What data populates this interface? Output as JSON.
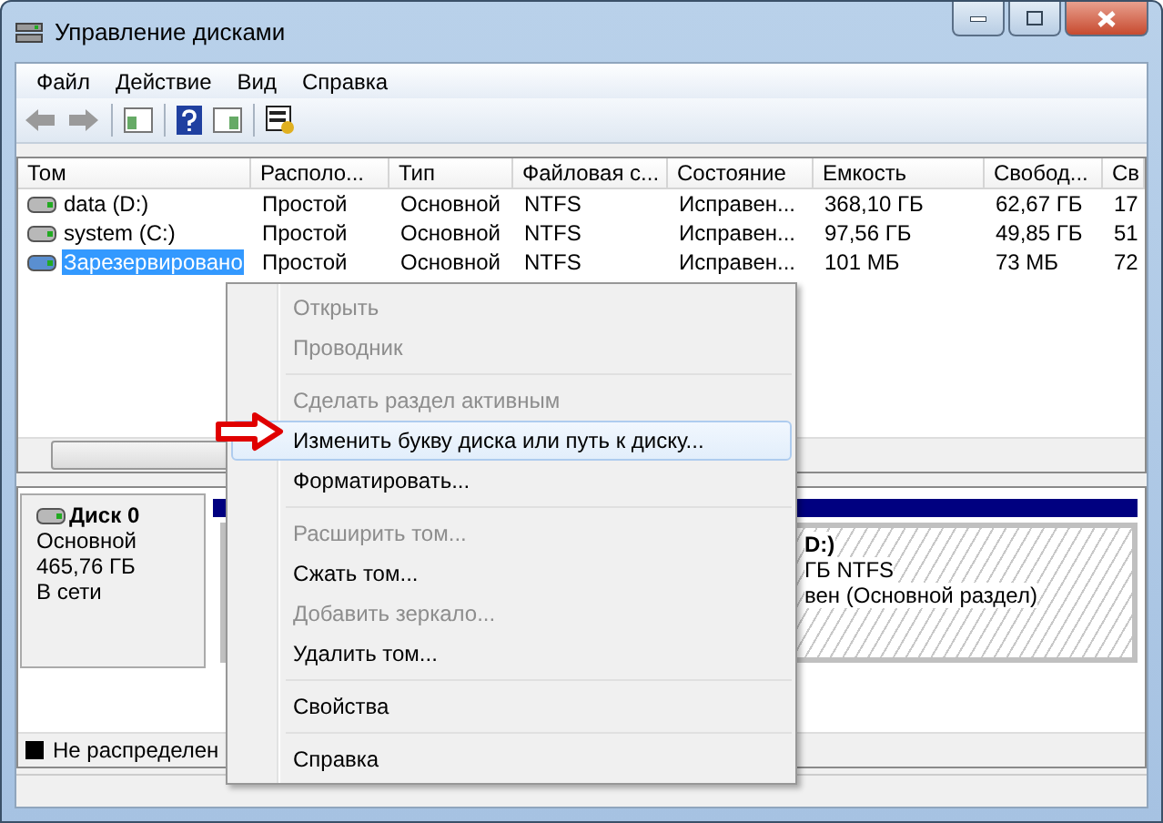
{
  "window": {
    "title": "Управление дисками"
  },
  "menu_bar": [
    "Файл",
    "Действие",
    "Вид",
    "Справка"
  ],
  "volumes": {
    "columns": [
      "Том",
      "Располо...",
      "Тип",
      "Файловая с...",
      "Состояние",
      "Емкость",
      "Свобод...",
      "Св"
    ],
    "rows": [
      {
        "selected": false,
        "cells": [
          "data (D:)",
          "Простой",
          "Основной",
          "NTFS",
          "Исправен...",
          "368,10 ГБ",
          "62,67 ГБ",
          "17"
        ]
      },
      {
        "selected": false,
        "cells": [
          "system (C:)",
          "Простой",
          "Основной",
          "NTFS",
          "Исправен...",
          "97,56 ГБ",
          "49,85 ГБ",
          "51"
        ]
      },
      {
        "selected": true,
        "cells": [
          "Зарезервировано",
          "Простой",
          "Основной",
          "NTFS",
          "Исправен...",
          "101 МБ",
          "73 МБ",
          "72"
        ]
      }
    ]
  },
  "disk": {
    "name": "Диск 0",
    "type": "Основной",
    "size": "465,76 ГБ",
    "status": "В сети"
  },
  "partition": {
    "lines": [
      "D:)",
      "ГБ NTFS",
      "вен (Основной раздел)"
    ]
  },
  "legend": [
    {
      "label": "Не распределен",
      "color": "#000000"
    }
  ],
  "context_menu": {
    "items": [
      {
        "kind": "item",
        "label": "Открыть",
        "disabled": true,
        "selected": false
      },
      {
        "kind": "item",
        "label": "Проводник",
        "disabled": true,
        "selected": false
      },
      {
        "kind": "separator"
      },
      {
        "kind": "item",
        "label": "Сделать раздел активным",
        "disabled": true,
        "selected": false
      },
      {
        "kind": "item",
        "label": "Изменить букву диска или путь к диску...",
        "disabled": false,
        "selected": true
      },
      {
        "kind": "item",
        "label": "Форматировать...",
        "disabled": false,
        "selected": false
      },
      {
        "kind": "separator"
      },
      {
        "kind": "item",
        "label": "Расширить том...",
        "disabled": true,
        "selected": false
      },
      {
        "kind": "item",
        "label": "Сжать том...",
        "disabled": false,
        "selected": false
      },
      {
        "kind": "item",
        "label": "Добавить зеркало...",
        "disabled": true,
        "selected": false
      },
      {
        "kind": "item",
        "label": "Удалить том...",
        "disabled": false,
        "selected": false
      },
      {
        "kind": "separator"
      },
      {
        "kind": "item",
        "label": "Свойства",
        "disabled": false,
        "selected": false
      },
      {
        "kind": "separator"
      },
      {
        "kind": "item",
        "label": "Справка",
        "disabled": false,
        "selected": false
      }
    ]
  }
}
